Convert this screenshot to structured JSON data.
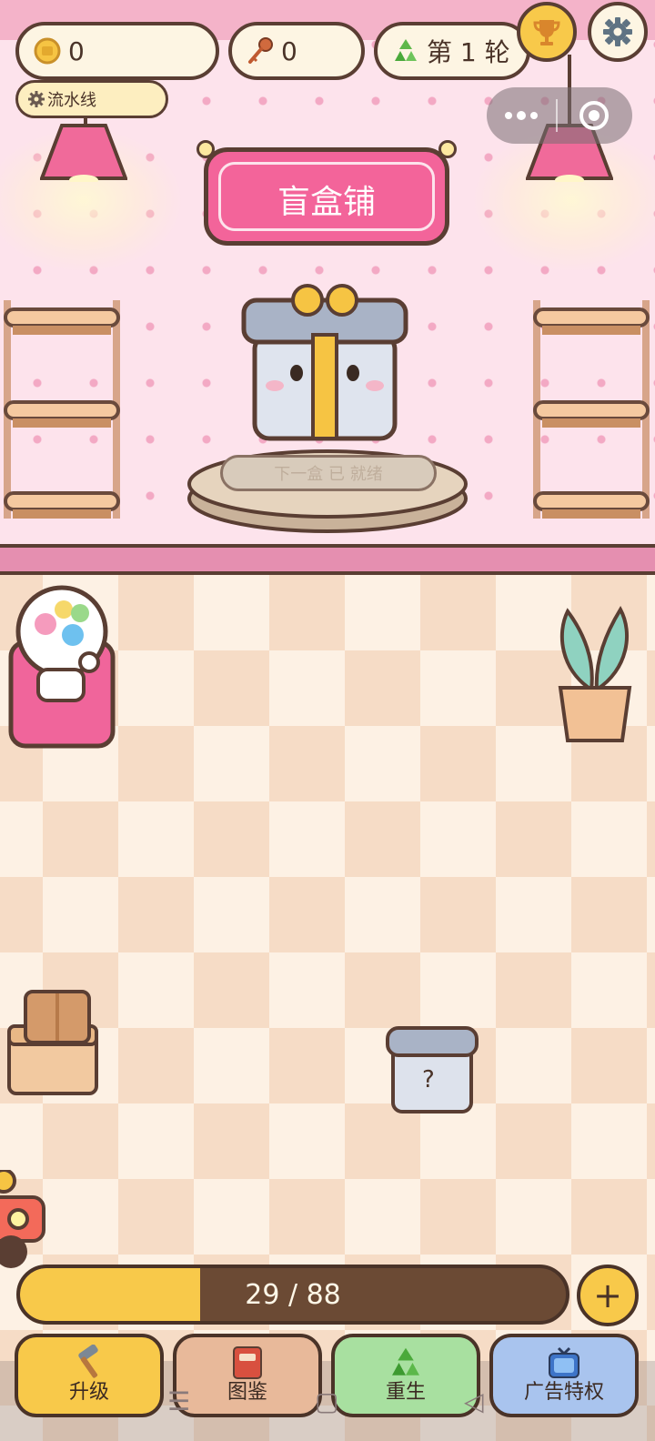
{
  "hud": {
    "coins": "0",
    "keys": "0",
    "round": "第 1 轮",
    "pipeline": "流水线"
  },
  "sign": {
    "title": "盲盒铺"
  },
  "pedestal": {
    "hint": "下一盒 已 就绪"
  },
  "floor_box": {
    "mark": "?"
  },
  "progress": {
    "text": "29 / 88",
    "current": 29,
    "max": 88
  },
  "plus_label": "+",
  "nav": [
    {
      "label": "升级",
      "color": "#f8c94a"
    },
    {
      "label": "图鉴",
      "color": "#e8b99a"
    },
    {
      "label": "重生",
      "color": "#a8e0a0"
    },
    {
      "label": "广告特权",
      "color": "#a9c4ee"
    }
  ],
  "colors": {
    "wall": "#fde3ec",
    "sign": "#f3649a",
    "outline": "#5a3e33",
    "accent_yellow": "#f8c94a"
  }
}
